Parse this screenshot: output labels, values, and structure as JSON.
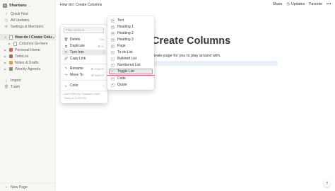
{
  "sidebar": {
    "workspace": {
      "avatar": "S",
      "name": "Shantanu",
      "chevron": "⌄"
    },
    "top_items": [
      {
        "icon": "search-icon",
        "glyph": "⌕",
        "label": "Quick Find"
      },
      {
        "icon": "clock-icon",
        "glyph": "◷",
        "label": "All Updates"
      },
      {
        "icon": "gear-icon",
        "glyph": "⚙",
        "label": "Settings & Members"
      }
    ],
    "pages": [
      {
        "label": "How do I Create Colu...",
        "active": true,
        "icon": "page-icon"
      },
      {
        "label": "Columns Go here",
        "active": false,
        "icon": "page-icon"
      },
      {
        "label": "Personal Home",
        "active": false,
        "icon": "emoji-icon",
        "color": "#c9684f"
      },
      {
        "label": "TodoList",
        "active": false,
        "icon": "emoji-icon",
        "color": "#d9534f"
      },
      {
        "label": "Notes & Drafts",
        "active": false,
        "icon": "emoji-icon",
        "color": "#e0a13a"
      },
      {
        "label": "Weekly Agenda",
        "active": false,
        "icon": "emoji-icon",
        "color": "#6aa84f"
      }
    ],
    "bottom_items": [
      {
        "icon": "import-icon",
        "glyph": "⤓",
        "label": "Import"
      },
      {
        "icon": "trash-icon",
        "glyph": "🗑",
        "label": "Trash"
      }
    ],
    "new_page": {
      "glyph": "+",
      "label": "New Page"
    }
  },
  "topbar": {
    "breadcrumb": "How do I Create Columns",
    "share": "Share",
    "updates": "Updates",
    "favorite": "Favorite",
    "more": "•••"
  },
  "page": {
    "title": "Create Columns",
    "paragraph": "rivate page for you to play around with."
  },
  "context_menu": {
    "filter_placeholder": "Filter actions...",
    "items": [
      {
        "label": "Delete",
        "icon": "trash-icon",
        "glyph": "🗑",
        "shortcut": "Del"
      },
      {
        "label": "Duplicate",
        "icon": "duplicate-icon",
        "glyph": "⧉",
        "shortcut": "⌘+D"
      },
      {
        "label": "Turn Into",
        "icon": "turn-into-icon",
        "glyph": "↻",
        "shortcut": "›"
      },
      {
        "label": "Copy Link",
        "icon": "link-icon",
        "glyph": "🔗",
        "shortcut": ""
      },
      {
        "label": "Rename",
        "icon": "rename-icon",
        "glyph": "✎",
        "shortcut": "⌘+Shift+R"
      },
      {
        "label": "Move To",
        "icon": "move-icon",
        "glyph": "↪",
        "shortcut": "⌘+Shift+P"
      },
      {
        "label": "Color",
        "icon": "color-icon",
        "glyph": "◐",
        "shortcut": "›"
      }
    ],
    "footer_line1": "Last Edited by Shantanu Joshi",
    "footer_line2": "Today at 10:59 PM"
  },
  "turn_into_menu": {
    "items": [
      {
        "label": "Text",
        "glyph": "Aa"
      },
      {
        "label": "Heading 1",
        "glyph": "H1"
      },
      {
        "label": "Heading 2",
        "glyph": "H2"
      },
      {
        "label": "Heading 3",
        "glyph": "H3"
      },
      {
        "label": "Page",
        "glyph": "▤"
      },
      {
        "label": "To-do List",
        "glyph": "☑"
      },
      {
        "label": "Bulleted List",
        "glyph": "•"
      },
      {
        "label": "Numbered List",
        "glyph": "1."
      },
      {
        "label": "Toggle List",
        "glyph": "▸"
      },
      {
        "label": "Code",
        "glyph": "</>"
      },
      {
        "label": "Quote",
        "glyph": "❝"
      }
    ]
  },
  "help": "?"
}
